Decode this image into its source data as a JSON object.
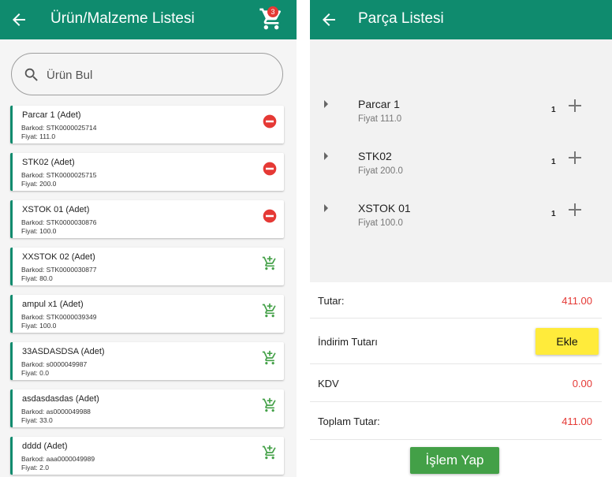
{
  "left": {
    "title": "Ürün/Malzeme Listesi",
    "cart_count": "3",
    "search": {
      "placeholder": "Ürün Bul"
    },
    "products": [
      {
        "name": "Parcar 1  (Adet)",
        "barkod": "Barkod: STK0000025714",
        "fiyat": "Fiyat:  111.0",
        "in_cart": true
      },
      {
        "name": "STK02  (Adet)",
        "barkod": "Barkod: STK0000025715",
        "fiyat": "Fiyat:  200.0",
        "in_cart": true
      },
      {
        "name": "XSTOK 01  (Adet)",
        "barkod": "Barkod: STK0000030876",
        "fiyat": "Fiyat:  100.0",
        "in_cart": true
      },
      {
        "name": "XXSTOK 02  (Adet)",
        "barkod": "Barkod: STK0000030877",
        "fiyat": "Fiyat:  80.0",
        "in_cart": false
      },
      {
        "name": "ampul x1  (Adet)",
        "barkod": "Barkod: STK0000039349",
        "fiyat": "Fiyat:  100.0",
        "in_cart": false
      },
      {
        "name": "33ASDASDSA  (Adet)",
        "barkod": "Barkod: s0000049987",
        "fiyat": "Fiyat:  0.0",
        "in_cart": false
      },
      {
        "name": "asdasdasdas  (Adet)",
        "barkod": "Barkod: as0000049988",
        "fiyat": "Fiyat:  33.0",
        "in_cart": false
      },
      {
        "name": "dddd  (Adet)",
        "barkod": "Barkod: aaa0000049989",
        "fiyat": "Fiyat:  2.0",
        "in_cart": false
      }
    ]
  },
  "right": {
    "title": "Parça Listesi",
    "parts": [
      {
        "name": "Parcar 1",
        "price": "Fiyat 111.0",
        "qty": "1"
      },
      {
        "name": "STK02",
        "price": "Fiyat 200.0",
        "qty": "1"
      },
      {
        "name": "XSTOK 01",
        "price": "Fiyat 100.0",
        "qty": "1"
      }
    ],
    "totals": {
      "tutar_label": "Tutar:",
      "tutar_value": "411.00",
      "indirim_label": "İndirim Tutarı",
      "ekle_label": "Ekle",
      "kdv_label": "KDV",
      "kdv_value": "0.00",
      "toplam_label": "Toplam Tutar:",
      "toplam_value": "411.00"
    },
    "submit_label": "İşlem Yap"
  },
  "colors": {
    "appbar": "#0f8b6e",
    "remove": "#e53935",
    "add": "#43a047",
    "ekle_button": "#ffeb3b",
    "value_red": "#e53935"
  }
}
